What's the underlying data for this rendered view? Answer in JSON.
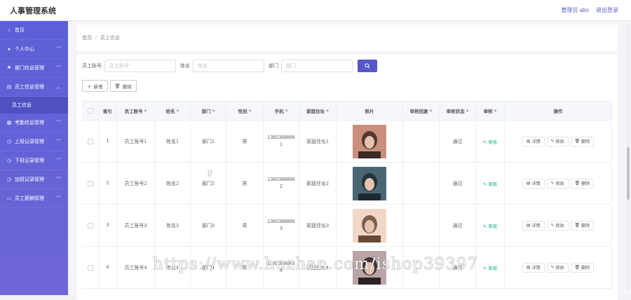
{
  "app": {
    "title": "人事管理系统"
  },
  "header": {
    "user_label": "管理员 abo",
    "logout_label": "退出登录"
  },
  "sidebar": {
    "items": [
      {
        "label": "首页",
        "icon": "home-icon",
        "expandable": false
      },
      {
        "label": "个人中心",
        "icon": "user-icon",
        "expandable": true
      },
      {
        "label": "部门信息管理",
        "icon": "flag-icon",
        "expandable": true
      },
      {
        "label": "员工信息管理",
        "icon": "table-icon",
        "expandable": true,
        "expanded": true
      },
      {
        "label": "考勤信息管理",
        "icon": "grid-icon",
        "expandable": true
      },
      {
        "label": "上班记录管理",
        "icon": "clock-icon",
        "expandable": true
      },
      {
        "label": "下班记录管理",
        "icon": "clock-icon",
        "expandable": true
      },
      {
        "label": "加班记录管理",
        "icon": "clock-icon",
        "expandable": true
      },
      {
        "label": "员工薪酬管理",
        "icon": "wallet-icon",
        "expandable": true
      }
    ],
    "submenu": {
      "label": "员工信息"
    }
  },
  "breadcrumb": {
    "home": "首页",
    "separator": "/",
    "current": "员工信息"
  },
  "search": {
    "emp_no_label": "员工账号",
    "emp_no_placeholder": "员工账号",
    "name_label": "姓名",
    "name_placeholder": "姓名",
    "dept_label": "部门",
    "dept_placeholder": "部门"
  },
  "toolbar": {
    "add_label": "新增",
    "delete_label": "删除"
  },
  "table": {
    "headers": [
      "索引",
      "员工账号",
      "姓名",
      "部门",
      "性别",
      "手机",
      "家庭住址",
      "照片",
      "审核回复",
      "审核状态",
      "审核",
      "操作"
    ],
    "audit_action": "审核",
    "op_detail": "详情",
    "op_edit": "修改",
    "op_delete": "删除",
    "rows": [
      {
        "index": "1",
        "emp_no": "员工账号1",
        "name": "姓名1",
        "dept": "部门1",
        "gender": "男",
        "phone_a": "1382388888",
        "phone_b": "1",
        "address": "家庭住址1",
        "reply": "",
        "status": "通过",
        "photo_palette": [
          "#3b2a25",
          "#c98f7c"
        ]
      },
      {
        "index": "2",
        "emp_no": "员工账号2",
        "name": "姓名2",
        "dept": "部门2",
        "gender": "男",
        "phone_a": "1382388888",
        "phone_b": "2",
        "address": "家庭住址2",
        "reply": "",
        "status": "通过",
        "photo_palette": [
          "#1e2a33",
          "#4a6673"
        ]
      },
      {
        "index": "3",
        "emp_no": "员工账号3",
        "name": "姓名3",
        "dept": "部门3",
        "gender": "男",
        "phone_a": "1382388888",
        "phone_b": "3",
        "address": "家庭住址3",
        "reply": "",
        "status": "通过",
        "photo_palette": [
          "#6b4a35",
          "#f1d7c8"
        ]
      },
      {
        "index": "4",
        "emp_no": "员工账号4",
        "name": "姓名4",
        "dept": "部门4",
        "gender": "男",
        "phone_a": "1382388888",
        "phone_b": "4",
        "address": "家庭住址4",
        "reply": "",
        "status": "通过",
        "photo_palette": [
          "#2a2326",
          "#b9a4a6"
        ]
      }
    ]
  },
  "watermark": "https://www.huzhan.com/ishop39397",
  "colors": {
    "sidebar": "#5c5fd6",
    "accent": "#5757c9",
    "audit": "#19b38a"
  }
}
